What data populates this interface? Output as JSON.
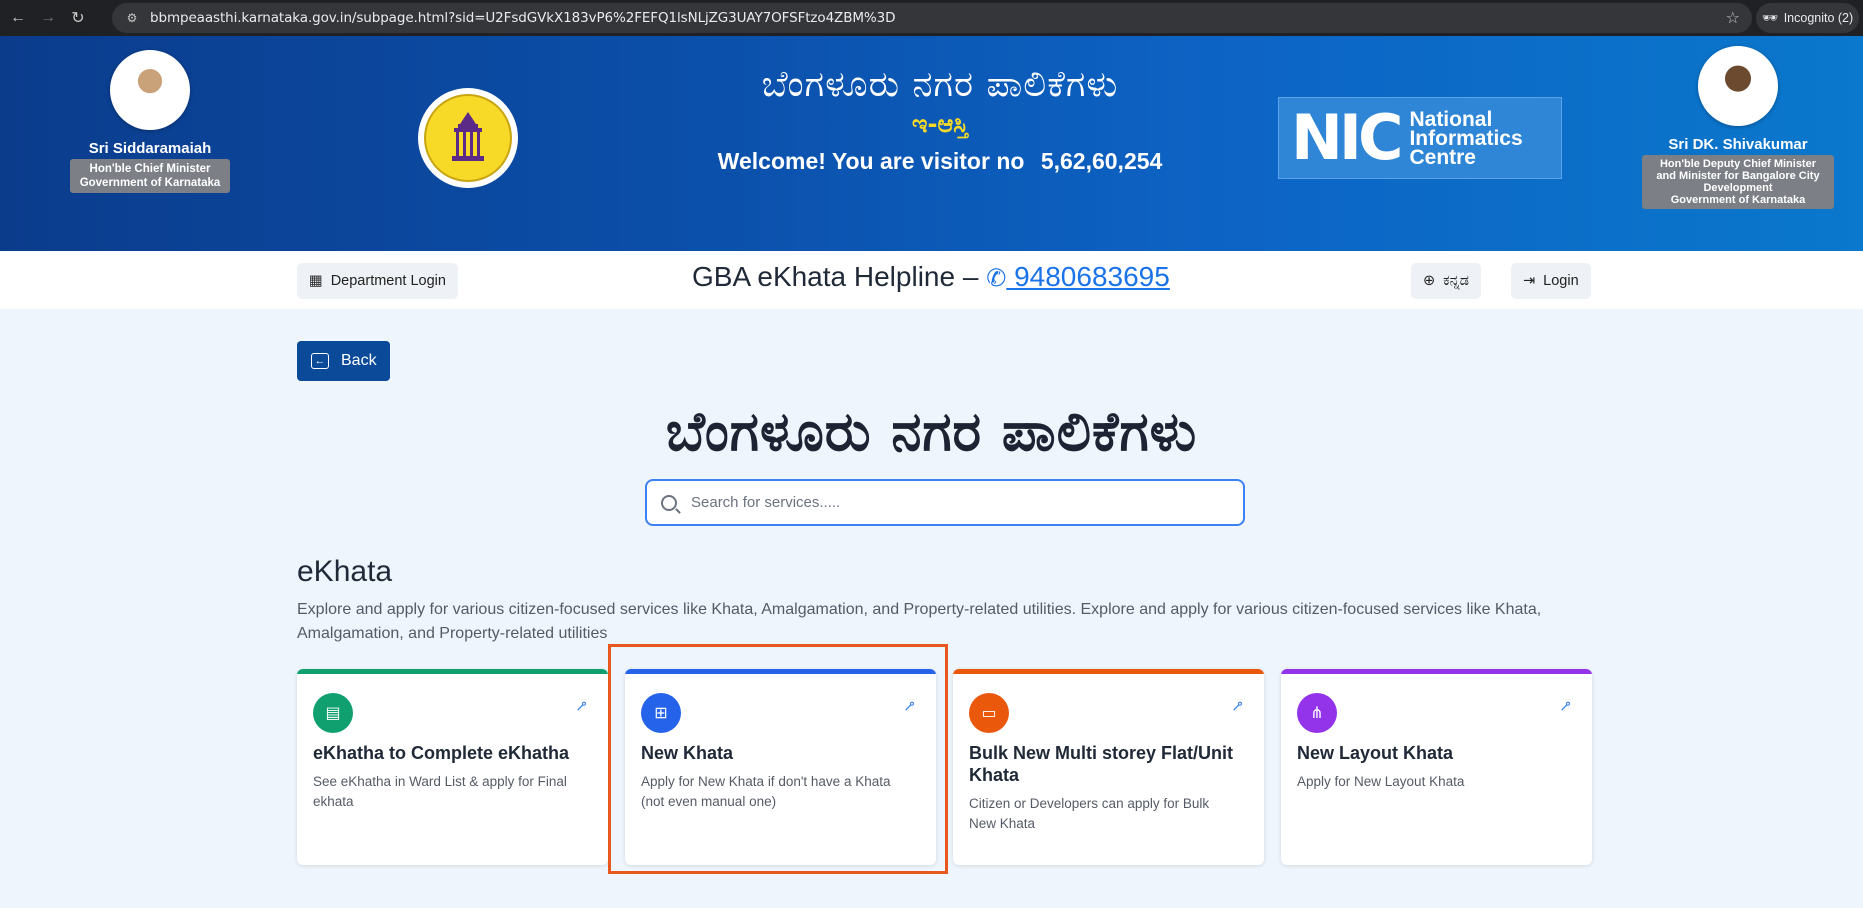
{
  "browser": {
    "url": "bbmpeaasthi.karnataka.gov.in/subpage.html?sid=U2FsdGVkX183vP6%2FEFQ1lsNLjZG3UAY7OFSFtzo4ZBM%3D",
    "incognito_label": "Incognito (2)"
  },
  "banner": {
    "title": "ಬೆಂಗಳೂರು ನಗರ ಪಾಲಿಕೆಗಳು",
    "subtitle": "ಇ-ಆಸ್ತಿ",
    "visitor_text": "Welcome! You are visitor no",
    "visitor_count": "5,62,60,254",
    "left_leader": {
      "name": "Sri Siddaramaiah",
      "role": "Hon'ble Chief Minister\nGovernment of Karnataka"
    },
    "right_leader": {
      "name": "Sri DK. Shivakumar",
      "role": "Hon'ble Deputy Chief Minister\nand Minister for Bangalore City\nDevelopment\nGovernment of Karnataka"
    },
    "nic_mark": "NIC",
    "nic_text": "National\nInformatics\nCentre"
  },
  "helpbar": {
    "department_login": "Department Login",
    "helpline_label": "GBA eKhata Helpline –",
    "helpline_phone": " 9480683695",
    "language": "ಕನ್ನಡ",
    "login": "Login"
  },
  "main": {
    "back_label": "Back",
    "title": "ಬೆಂಗಳೂರು ನಗರ ಪಾಲಿಕೆಗಳು",
    "search_placeholder": "Search for services.....",
    "section_title": "eKhata",
    "section_desc": "Explore and apply for various citizen-focused services like Khata, Amalgamation, and Property-related utilities. Explore and apply for various citizen-focused services like Khata, Amalgamation, and Property-related utilities",
    "cards": [
      {
        "title": "eKhatha to Complete eKhatha",
        "desc": "See eKhatha in Ward List & apply for Final ekhata",
        "color": "#10a070",
        "icon": "document-icon"
      },
      {
        "title": "New Khata",
        "desc": "Apply for New Khata if don't have a Khata (not even manual one)",
        "color": "#2563eb",
        "icon": "add-document-icon"
      },
      {
        "title": "Bulk New Multi storey Flat/Unit Khata",
        "desc": "Citizen or Developers can apply for Bulk New Khata",
        "color": "#ea580c",
        "icon": "briefcase-icon"
      },
      {
        "title": "New Layout Khata",
        "desc": "Apply for New Layout Khata",
        "color": "#9333ea",
        "icon": "sitemap-icon"
      }
    ]
  }
}
